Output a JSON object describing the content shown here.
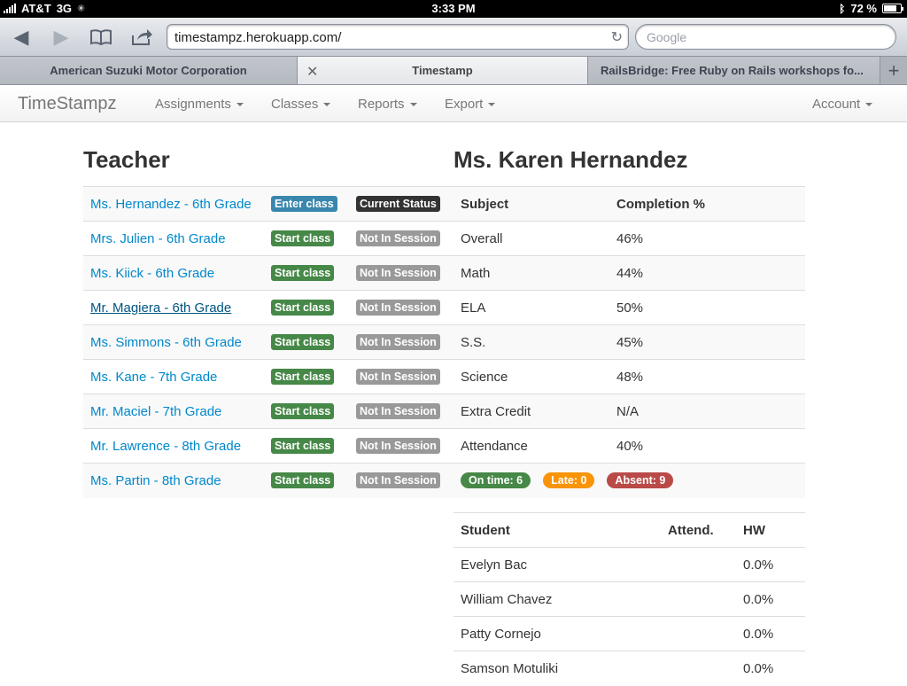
{
  "status_bar": {
    "carrier": "AT&T",
    "network": "3G",
    "time": "3:33 PM",
    "battery": "72 %"
  },
  "browser": {
    "url": "timestampz.herokuapp.com/",
    "search_placeholder": "Google",
    "tabs": [
      {
        "title": "American Suzuki Motor Corporation"
      },
      {
        "title": "Timestamp"
      },
      {
        "title": "RailsBridge: Free Ruby on Rails workshops fo..."
      }
    ]
  },
  "navbar": {
    "brand": "TimeStampz",
    "items": [
      "Assignments",
      "Classes",
      "Reports",
      "Export"
    ],
    "account": "Account"
  },
  "teacher_section": {
    "heading": "Teacher",
    "rows": [
      {
        "name": "Ms. Hernandez - 6th Grade",
        "action": "Enter class",
        "status": "Current Status"
      },
      {
        "name": "Mrs. Julien - 6th Grade",
        "action": "Start class",
        "status": "Not In Session"
      },
      {
        "name": "Ms. Kiick - 6th Grade",
        "action": "Start class",
        "status": "Not In Session"
      },
      {
        "name": "Mr. Magiera - 6th Grade",
        "action": "Start class",
        "status": "Not In Session"
      },
      {
        "name": "Ms. Simmons - 6th Grade",
        "action": "Start class",
        "status": "Not In Session"
      },
      {
        "name": "Ms. Kane - 7th Grade",
        "action": "Start class",
        "status": "Not In Session"
      },
      {
        "name": "Mr. Maciel - 7th Grade",
        "action": "Start class",
        "status": "Not In Session"
      },
      {
        "name": "Mr. Lawrence - 8th Grade",
        "action": "Start class",
        "status": "Not In Session"
      },
      {
        "name": "Ms. Partin - 8th Grade",
        "action": "Start class",
        "status": "Not In Session"
      }
    ]
  },
  "class_section": {
    "heading": "Ms. Karen Hernandez",
    "columns": [
      "Subject",
      "Completion %"
    ],
    "rows": [
      {
        "subject": "Overall",
        "completion": "46%"
      },
      {
        "subject": "Math",
        "completion": "44%"
      },
      {
        "subject": "ELA",
        "completion": "50%"
      },
      {
        "subject": "S.S.",
        "completion": "45%"
      },
      {
        "subject": "Science",
        "completion": "48%"
      },
      {
        "subject": "Extra Credit",
        "completion": "N/A"
      },
      {
        "subject": "Attendance",
        "completion": "40%"
      }
    ],
    "attendance_badges": {
      "on_time": "On time: 6",
      "late": "Late: 0",
      "absent": "Absent: 9"
    }
  },
  "students": {
    "columns": [
      "Student",
      "Attend.",
      "HW"
    ],
    "rows": [
      {
        "name": "Evelyn Bac",
        "attend": "",
        "hw": "0.0%"
      },
      {
        "name": "William Chavez",
        "attend": "",
        "hw": "0.0%"
      },
      {
        "name": "Patty Cornejo",
        "attend": "",
        "hw": "0.0%"
      },
      {
        "name": "Samson Motuliki",
        "attend": "",
        "hw": "0.0%"
      }
    ]
  }
}
